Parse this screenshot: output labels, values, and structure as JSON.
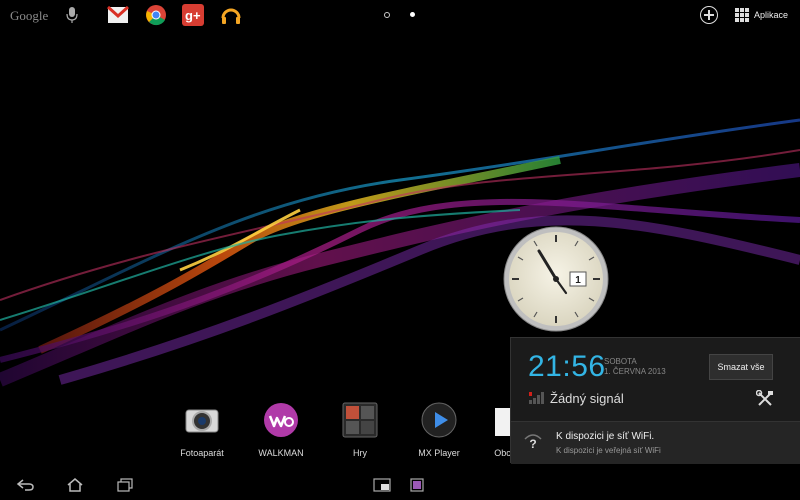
{
  "topbar": {
    "google_label": "Google",
    "apps_label": "Aplikace",
    "app_icons": [
      "gmail-icon",
      "chrome-icon",
      "google-plus-icon",
      "play-music-icon"
    ]
  },
  "dock": {
    "items": [
      {
        "label": "Fotoaparát",
        "icon": "camera-icon"
      },
      {
        "label": "WALKMAN",
        "icon": "walkman-icon"
      },
      {
        "label": "Hry",
        "icon": "games-icon"
      },
      {
        "label": "MX Player",
        "icon": "mx-player-icon"
      },
      {
        "label": "Obch",
        "icon": "store-icon"
      }
    ]
  },
  "clock_widget": {
    "date_number": "1"
  },
  "notification_panel": {
    "time": "21:56",
    "day": "SOBOTA",
    "date": "1. ČERVNA 2013",
    "clear_label": "Smazat vše",
    "signal_text": "Žádný signál",
    "wifi_title": "K dispozici je síť WiFi.",
    "wifi_subtitle": "K dispozici je veřejná síť WiFi"
  },
  "colors": {
    "accent": "#33b5e5",
    "panel_bg": "#1b1b1b"
  }
}
